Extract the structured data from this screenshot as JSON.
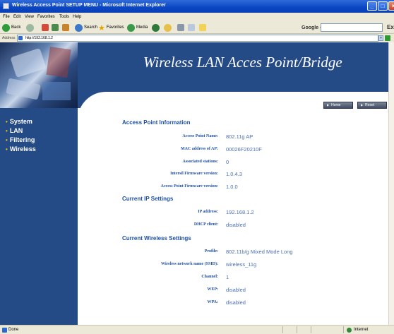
{
  "window": {
    "title": "Wireless Access Point SETUP MENU - Microsoft Internet Explorer",
    "controls": {
      "minimize": "_",
      "maximize": "□",
      "close": "×"
    }
  },
  "menu": [
    "File",
    "Edit",
    "View",
    "Favorites",
    "Tools",
    "Help"
  ],
  "toolbar": {
    "back_label": "Back",
    "search_label": "Search",
    "favorites_label": "Favorites",
    "media_label": "Media",
    "google_label": "Google -",
    "right_label": "Ex"
  },
  "address": {
    "label": "Address",
    "value": "http://192.168.1.2",
    "go_label": "Go"
  },
  "page": {
    "title": "Wireless LAN Acces Point/Bridge",
    "nav": [
      "System",
      "LAN",
      "Filtering",
      "Wireless"
    ],
    "buttons": {
      "home": "Home",
      "reset": "Reset"
    },
    "sections": {
      "ap_info": {
        "heading": "Access Point Information",
        "rows": [
          {
            "label": "Access Point Name:",
            "value": "802.11g AP"
          },
          {
            "label": "MAC address of AP:",
            "value": "00026F20210F"
          },
          {
            "label": "Associated stations:",
            "value": "0"
          },
          {
            "label": "Intersil Firmware version:",
            "value": "1.0.4.3"
          },
          {
            "label": "Access Point Firmware version:",
            "value": "1.0.0"
          }
        ]
      },
      "ip": {
        "heading": "Current IP Settings",
        "rows": [
          {
            "label": "IP address:",
            "value": "192.168.1.2"
          },
          {
            "label": "DHCP client:",
            "value": "disabled"
          }
        ]
      },
      "wireless": {
        "heading": "Current Wireless Settings",
        "rows": [
          {
            "label": "Profile:",
            "value": "802.11b/g Mixed Mode Long"
          },
          {
            "label": "Wireless network name (SSID):",
            "value": "wireless_11g"
          },
          {
            "label": "Channel:",
            "value": "1"
          },
          {
            "label": "WEP:",
            "value": "disabled"
          },
          {
            "label": "WPA:",
            "value": "disabled"
          }
        ]
      }
    }
  },
  "status": {
    "text": "Done",
    "zone": "Internet"
  },
  "colors": {
    "brand_blue": "#254b86",
    "heading_blue": "#1d4fa3",
    "value_blue": "#4a6fb5",
    "nav_dot": "#f2c200"
  }
}
